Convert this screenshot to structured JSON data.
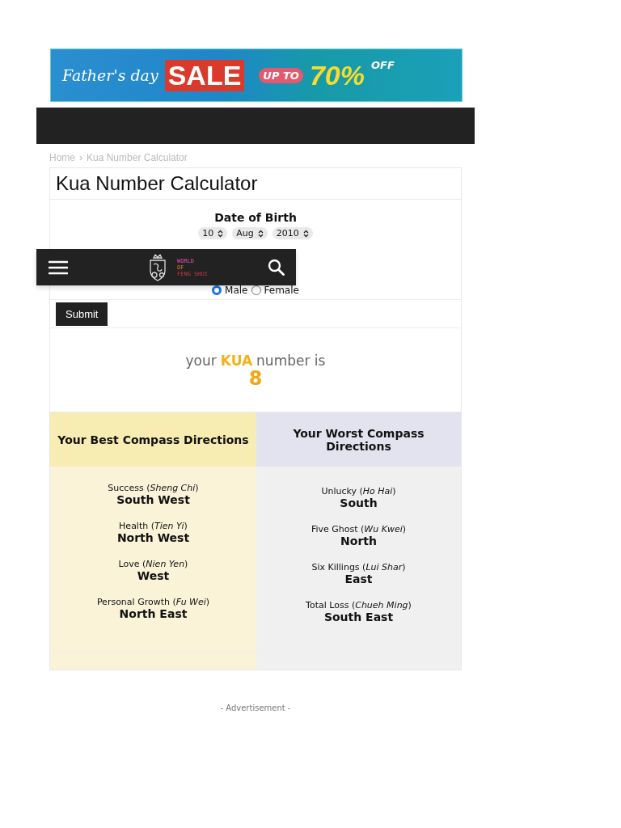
{
  "banner": {
    "script": "Father's day",
    "sale": "SALE",
    "up_to": "UP TO",
    "percent": "70%",
    "off": "OFF"
  },
  "breadcrumb": {
    "items": [
      "Home",
      "Kua Number Calculator"
    ],
    "separator": "›"
  },
  "title": "Kua Number Calculator",
  "form": {
    "label": "Date of Birth",
    "selects": [
      "10",
      "Aug",
      "2010"
    ],
    "genders": [
      {
        "label": "Male",
        "selected": true
      },
      {
        "label": "Female",
        "selected": false
      }
    ],
    "submit": "Submit"
  },
  "result": {
    "prefix": "your",
    "highlight": "KUA",
    "suffix": "number is",
    "number": "8"
  },
  "directions": [
    {
      "heading": "Your Best Compass Directions",
      "kind": "best",
      "items": [
        {
          "label": "Success (*Sheng Chi*)",
          "direction": "South West"
        },
        {
          "label": "Health (*Tien Yi*)",
          "direction": "North West"
        },
        {
          "label": "Love (*Nien Yen*)",
          "direction": "West"
        },
        {
          "label": "Personal Growth (*Fu Wei*)",
          "direction": "North East"
        }
      ]
    },
    {
      "heading": "Your Worst Compass Directions",
      "kind": "worst",
      "items": [
        {
          "label": "Unlucky (*Ho Hai*)",
          "direction": "South"
        },
        {
          "label": "Five Ghost (*Wu Kwei*)",
          "direction": "North"
        },
        {
          "label": "Six Killings (*Lui Shar*)",
          "direction": "East"
        },
        {
          "label": "Total Loss (*Chueh Ming*)",
          "direction": "South East"
        }
      ]
    }
  ],
  "advertisement": "- Advertisement -",
  "sticky_header": {
    "logo": [
      "WORLD",
      "OF",
      "FENG SHUI"
    ]
  }
}
